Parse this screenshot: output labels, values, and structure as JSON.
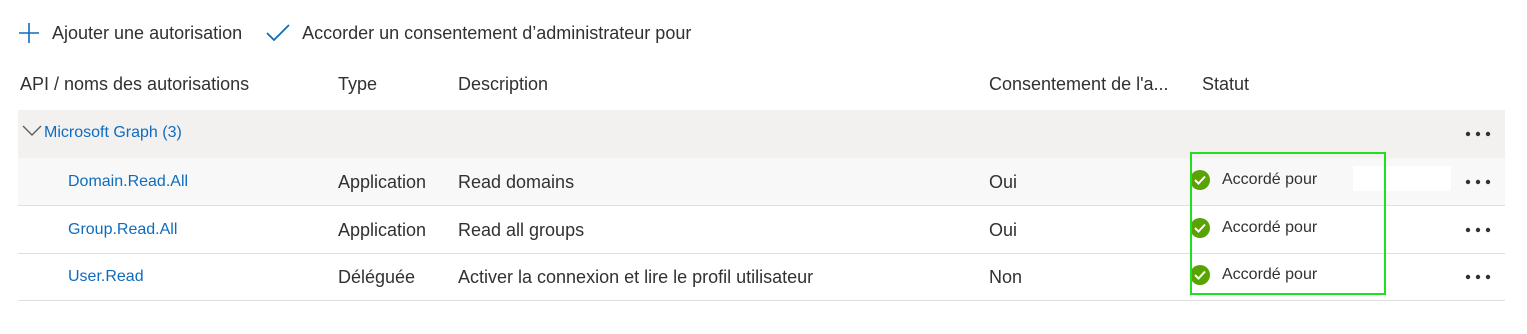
{
  "toolbar": {
    "add_label": "Ajouter une autorisation",
    "consent_label": "Accorder un consentement d’administrateur pour"
  },
  "columns": {
    "api": "API / noms des autorisations",
    "type": "Type",
    "description": "Description",
    "admin_consent": "Consentement de l'a...",
    "status": "Statut"
  },
  "group": {
    "label": "Microsoft Graph (3)"
  },
  "rows": [
    {
      "name": "Domain.Read.All",
      "type": "Application",
      "description": "Read domains",
      "admin_consent": "Oui",
      "status": "Accordé pour"
    },
    {
      "name": "Group.Read.All",
      "type": "Application",
      "description": "Read all groups",
      "admin_consent": "Oui",
      "status": "Accordé pour"
    },
    {
      "name": "User.Read",
      "type": "Déléguée",
      "description": "Activer la connexion et lire le profil utilisateur",
      "admin_consent": "Non",
      "status": "Accordé pour"
    }
  ],
  "colors": {
    "link": "#0f6cbd",
    "success": "#57a300",
    "highlight_box": "#22dd22"
  },
  "icons": {
    "add": "plus-icon",
    "consent": "checkmark-icon",
    "expand": "chevron-down-icon",
    "more": "more-icon",
    "status": "success-check-icon"
  }
}
